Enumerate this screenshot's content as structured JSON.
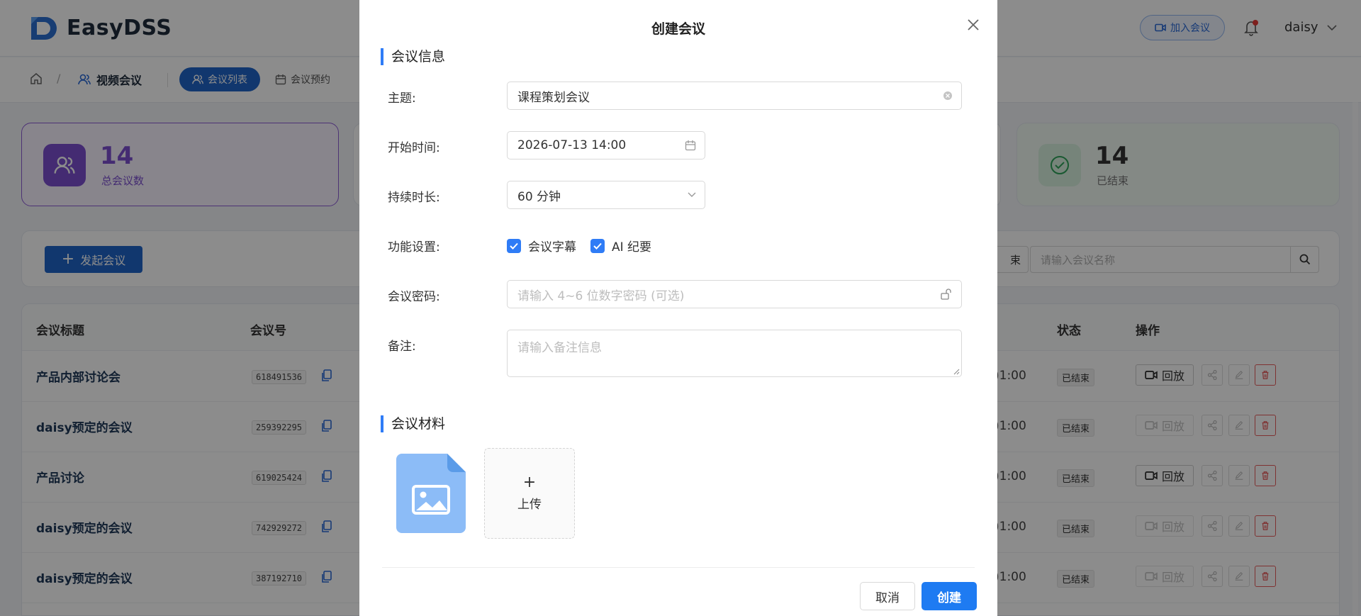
{
  "app": {
    "brand": "EasyDSS",
    "join_meeting": "加入会议",
    "username": "daisy"
  },
  "breadcrumb": {
    "section": "视频会议",
    "tab_list": "会议列表",
    "tab_schedule": "会议预约"
  },
  "stats": [
    {
      "value": "14",
      "label": "总会议数",
      "color": "#7c4fd0"
    },
    {
      "value": "14",
      "label": "已结束",
      "color": "#2fa35a"
    }
  ],
  "actions": {
    "start_meeting": "发起会议",
    "fragment_button": "束",
    "search_placeholder": "请输入会议名称"
  },
  "table": {
    "headers": [
      "会议标题",
      "会议号",
      "状态",
      "操作"
    ],
    "rows": [
      {
        "title": "产品内部讨论会",
        "id": "618491536",
        "time": ")1:00",
        "status": "已结束",
        "play": "回放",
        "play_enabled": true
      },
      {
        "title": "daisy预定的会议",
        "id": "259392295",
        "time": ")1:00",
        "status": "已结束",
        "play": "回放",
        "play_enabled": false
      },
      {
        "title": "产品讨论",
        "id": "619025424",
        "time": ")1:00",
        "status": "已结束",
        "play": "回放",
        "play_enabled": true
      },
      {
        "title": "daisy预定的会议",
        "id": "742929272",
        "time": ")1:00",
        "status": "已结束",
        "play": "回放",
        "play_enabled": false
      },
      {
        "title": "daisy预定的会议",
        "id": "387192710",
        "time": ")1:00",
        "status": "已结束",
        "play": "回放",
        "play_enabled": false
      }
    ]
  },
  "modal": {
    "title": "创建会议",
    "section_info": "会议信息",
    "section_materials": "会议材料",
    "fields": {
      "subject_label": "主题:",
      "subject_value": "课程策划会议",
      "start_label": "开始时间:",
      "start_value": "2026-07-13 14:00",
      "duration_label": "持续时长:",
      "duration_value": "60 分钟",
      "features_label": "功能设置:",
      "feature_subtitles": "会议字幕",
      "feature_ai_summary": "AI 纪要",
      "password_label": "会议密码:",
      "password_placeholder": "请输入 4~6 位数字密码 (可选)",
      "notes_label": "备注:",
      "notes_placeholder": "请输入备注信息"
    },
    "upload_label": "上传",
    "upload_plus": "+",
    "cancel": "取消",
    "create": "创建"
  },
  "colors": {
    "primary": "#1e7bf2",
    "accent_purple": "#7c4fd0",
    "success_green": "#2fa35a",
    "danger": "#e85c5c"
  }
}
